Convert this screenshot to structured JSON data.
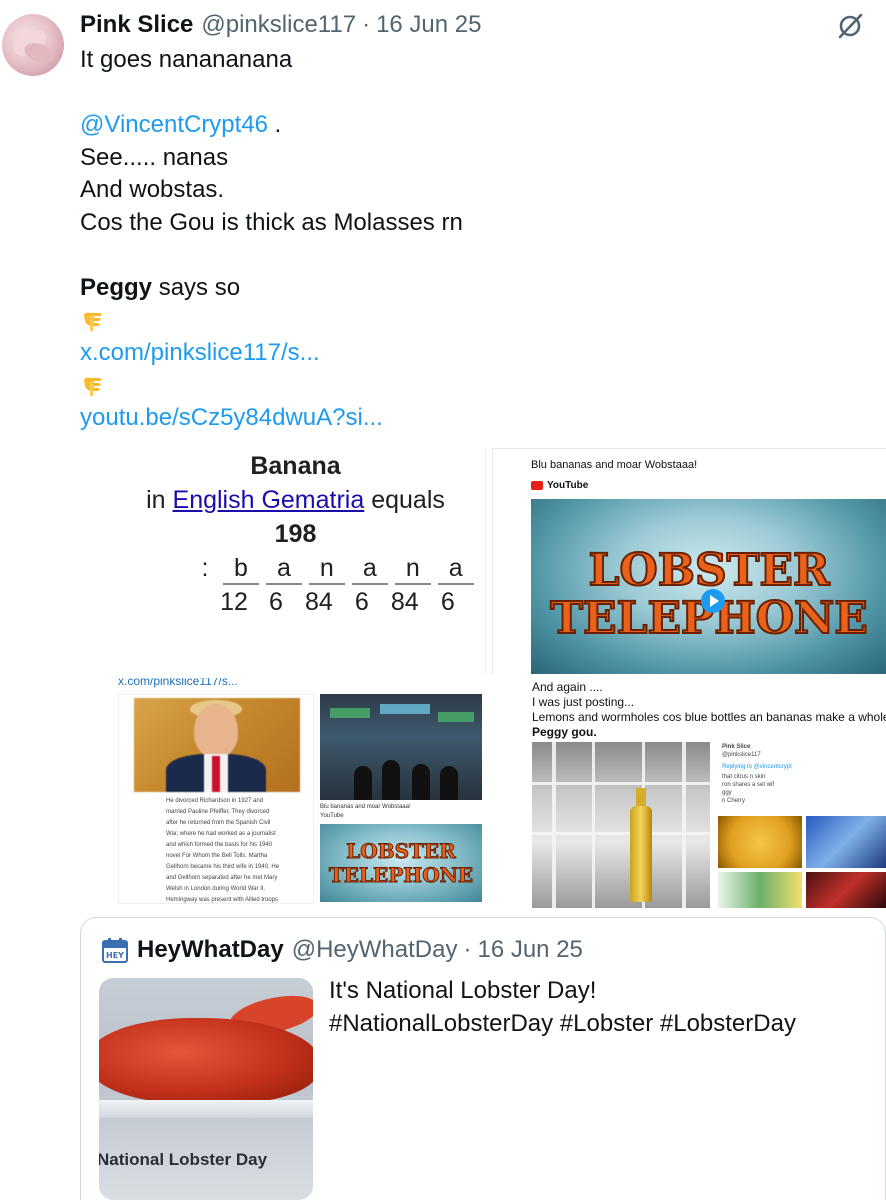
{
  "tweet": {
    "author_name": "Pink Slice",
    "author_handle": "@pinkslice117",
    "separator": "·",
    "date": "16 Jun 25",
    "lines": {
      "l1": "It goes nanananana",
      "mention": "@VincentCrypt46",
      "mention_suffix": " .",
      "l3": "See..... nanas",
      "l4": "And wobstas.",
      "l5": "Cos the Gou is thick as Molasses rn",
      "peggy_bold": "Peggy",
      "peggy_rest": " says so",
      "link1": "x.com/pinkslice117/s...",
      "link2": "youtu.be/sCz5y84dwuA?si..."
    }
  },
  "media": {
    "gematria": {
      "title": "Banana",
      "line_prefix": "in ",
      "line_link": "English Gematria",
      "line_suffix": " equals",
      "total": "198",
      "colon": ":",
      "letters": [
        "b",
        "a",
        "n",
        "a",
        "n",
        "a"
      ],
      "values": [
        "12",
        "6",
        "84",
        "6",
        "84",
        "6"
      ]
    },
    "youtube_card": {
      "title": "Blu bananas and moar Wobstaaa!",
      "source": "YouTube",
      "logo_text_1": "LOBSTER",
      "logo_text_2": "TELEPHONE"
    },
    "screenshot_left": {
      "url": "x.com/pinkslice117/s...",
      "article_lines": [
        "He divorced Richardson in 1927 and",
        "married Pauline Pfeiffer. They divorced",
        "after he returned from the Spanish Civil",
        "War, where he had worked as a journalist",
        "and which formed the basis for his 1940",
        "novel For Whom the Bell Tolls. Martha",
        "Gellhorn became his third wife in 1940. He",
        "and Gellhorn separated after he met Mary",
        "Welsh in London during World War II.",
        "Hemingway was present with Allied troops"
      ],
      "mini_title": "Blu bananas and moar Wobstaaa!",
      "mini_source": "YouTube"
    },
    "screenshot_right": {
      "line1": "And again ....",
      "line2": "I was just posting...",
      "line3": "Lemons and wormholes cos blue bottles an bananas make a whole lot",
      "line4": "Peggy gou.",
      "mini_name": "Pink Slice",
      "mini_handle": "@pinkslice117",
      "mini_reply": "Replying to @vincentcrypt",
      "mini_l1": "that citrus n skin",
      "mini_l2": "ron shares a set wif",
      "mini_l3": "ggy",
      "mini_l4": "n Cherry"
    }
  },
  "quote": {
    "author_name": "HeyWhatDay",
    "author_handle": "@HeyWhatDay",
    "separator": "·",
    "date": "16 Jun 25",
    "icon_text": "HEY",
    "text_l1": "It's National Lobster Day!",
    "text_l2": "#NationalLobsterDay #Lobster #LobsterDay",
    "image_label": "National Lobster Day"
  },
  "colors": {
    "link": "#1d9bf0",
    "secondary": "#536471",
    "text": "#0f1419"
  },
  "icons": {
    "more": "grok-slash-icon",
    "pointing": "backhand-index-pointing-down-icon",
    "calendar": "calendar-icon"
  }
}
